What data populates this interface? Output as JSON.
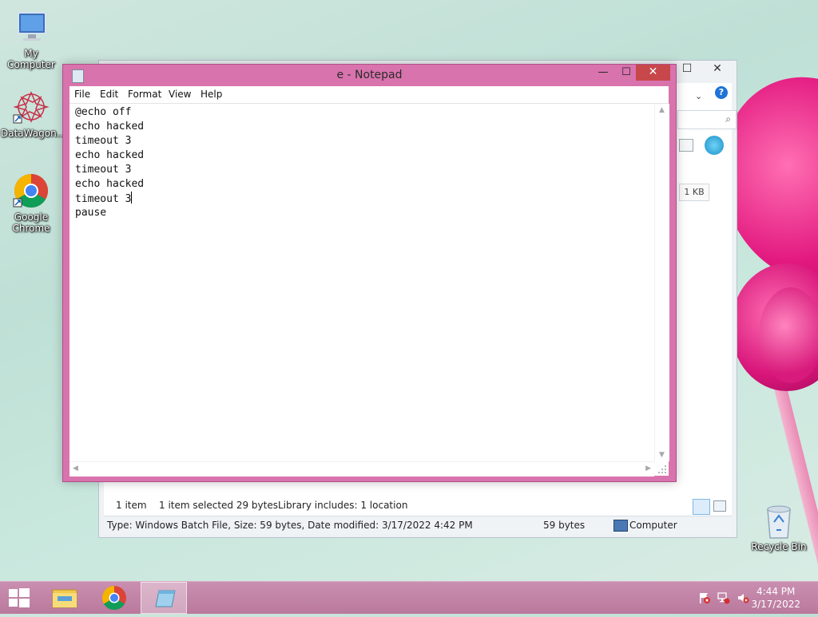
{
  "desktop": {
    "icons": [
      {
        "label": "My Computer"
      },
      {
        "label": "DataWagon..."
      },
      {
        "label": "Google Chrome"
      },
      {
        "label": "Recycle Bin"
      }
    ]
  },
  "explorer": {
    "status": {
      "items": "1 item",
      "selected": "1 item selected  29 bytes",
      "library": "Library includes: 1 location"
    },
    "size_badge": "1 KB",
    "details": {
      "type_text": "Type: Windows Batch File, Size: 59 bytes, Date modified: 3/17/2022 4:42 PM",
      "size": "59 bytes",
      "location": "Computer"
    }
  },
  "notepad": {
    "title": "e - Notepad",
    "controls": {
      "minimize": "—",
      "maximize": "☐",
      "close": "✕"
    },
    "menu": [
      "File",
      "Edit",
      "Format",
      "View",
      "Help"
    ],
    "lines": [
      "@echo off",
      "echo hacked",
      "timeout 3",
      "echo hacked",
      "timeout 3",
      "echo hacked",
      "timeout 3",
      "pause"
    ]
  },
  "taskbar": {
    "time": "4:44 PM",
    "date": "3/17/2022",
    "apps": [
      "file-explorer",
      "google-chrome",
      "notepad"
    ]
  },
  "colors": {
    "notepad_frame": "#d873ad",
    "close_button": "#c7474a",
    "taskbar": "#c08aa9"
  }
}
